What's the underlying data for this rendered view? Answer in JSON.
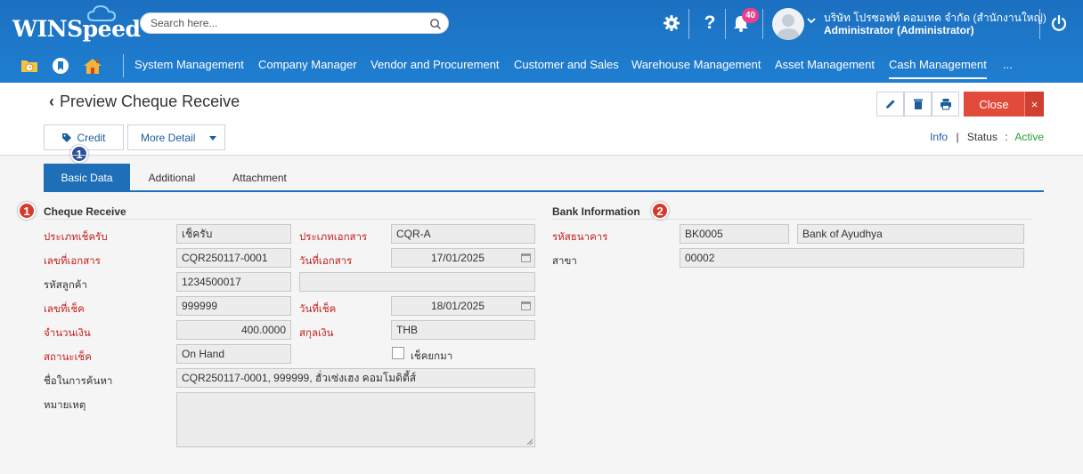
{
  "app": {
    "logo_text": "WINSpeed"
  },
  "search": {
    "placeholder": "Search here..."
  },
  "header": {
    "notification_count": "40",
    "company": "บริษัท โปรซอฟท์ คอมเทค จำกัด (สำนักงานใหญ่)",
    "user": "Administrator (Administrator)"
  },
  "nav": {
    "items": [
      {
        "label": "System Management"
      },
      {
        "label": "Company Manager"
      },
      {
        "label": "Vendor and Procurement"
      },
      {
        "label": "Customer and Sales"
      },
      {
        "label": "Warehouse Management"
      },
      {
        "label": "Asset Management"
      },
      {
        "label": "Cash Management"
      },
      {
        "label": "..."
      }
    ],
    "active": "Cash Management"
  },
  "page": {
    "title": "Preview Cheque Receive",
    "close_label": "Close",
    "close_x": "×",
    "credit_label": "Credit",
    "more_detail_label": "More Detail",
    "info_label": "Info",
    "status_label": "Status",
    "status_colon": ":",
    "status_value": "Active",
    "marker_1": "1",
    "marker_2": "2"
  },
  "tabs": [
    {
      "label": "Basic Data"
    },
    {
      "label": "Additional"
    },
    {
      "label": "Attachment"
    }
  ],
  "cheque": {
    "title": "Cheque Receive",
    "labels": {
      "cheque_type": "ประเภทเช็ครับ",
      "doc_type": "ประเภทเอกสาร",
      "doc_no": "เลขที่เอกสาร",
      "doc_date": "วันที่เอกสาร",
      "customer_code": "รหัสลูกค้า",
      "cheque_no": "เลขที่เช็ค",
      "cheque_date": "วันที่เช็ค",
      "amount": "จำนวนเงิน",
      "currency": "สกุลเงิน",
      "cheque_status": "สถานะเช็ค",
      "cheque_return": "เช็คยกมา",
      "search_name": "ชื่อในการค้นหา",
      "remark": "หมายเหตุ"
    },
    "values": {
      "cheque_type": "เช็ครับ",
      "doc_type": "CQR-A",
      "doc_no": "CQR250117-0001",
      "doc_date": "17/01/2025",
      "customer_code": "1234500017",
      "customer_name": "",
      "cheque_no": "999999",
      "cheque_date": "18/01/2025",
      "amount": "400.0000",
      "currency": "THB",
      "cheque_status": "On Hand",
      "search_name": "CQR250117-0001, 999999, ฮั่วเซ่งเฮง คอมโมดิตี้ส์",
      "remark": ""
    }
  },
  "bank": {
    "title": "Bank Information",
    "labels": {
      "bank_code": "รหัสธนาคาร",
      "branch": "สาขา"
    },
    "values": {
      "bank_code": "BK0005",
      "bank_name": "Bank of Ayudhya",
      "branch": "00002"
    }
  },
  "colors": {
    "header_blue": "#1e78c9",
    "tab_active": "#1e6fb8",
    "close_red": "#e24a3b",
    "required_red": "#c41f1f",
    "status_green": "#2a9d3a"
  }
}
